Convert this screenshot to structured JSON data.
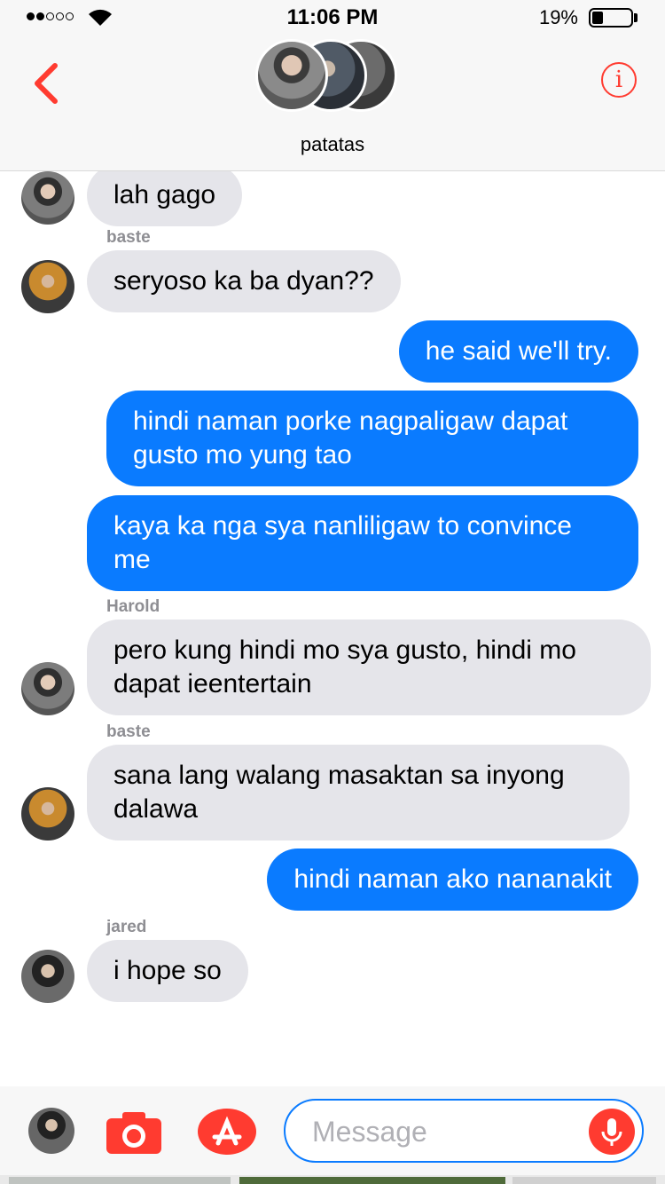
{
  "status_bar": {
    "time": "11:06 PM",
    "battery_percent": "19%",
    "battery_level": 0.19,
    "signal_bars_filled": 2,
    "signal_bars_total": 5
  },
  "header": {
    "group_name": "patatas",
    "back_icon": "chevron-left-icon",
    "info_icon": "info-icon",
    "info_glyph": "i"
  },
  "colors": {
    "accent": "#ff3b30",
    "outgoing_bubble": "#0a7bff",
    "incoming_bubble": "#e5e5ea"
  },
  "messages": [
    {
      "direction": "in",
      "sender": "",
      "text": "lah gago"
    },
    {
      "direction": "in",
      "sender": "baste",
      "text": "seryoso ka ba dyan??"
    },
    {
      "direction": "out",
      "text": "he said we'll try."
    },
    {
      "direction": "out",
      "text": "hindi naman porke nagpaligaw dapat\ngusto mo yung tao"
    },
    {
      "direction": "out",
      "text": "kaya ka nga sya nanliligaw to convince\nme"
    },
    {
      "direction": "in",
      "sender": "Harold",
      "text": "pero kung hindi mo sya gusto, hindi mo\ndapat ieentertain"
    },
    {
      "direction": "in",
      "sender": "baste",
      "text": "sana lang walang masaktan sa inyong\ndalawa"
    },
    {
      "direction": "out",
      "text": "hindi naman ako nananakit"
    },
    {
      "direction": "in",
      "sender": "jared",
      "text": "i hope so"
    }
  ],
  "composer": {
    "placeholder": "Message",
    "value": "",
    "camera_icon": "camera-icon",
    "apps_icon": "app-store-icon",
    "mic_icon": "microphone-icon"
  }
}
